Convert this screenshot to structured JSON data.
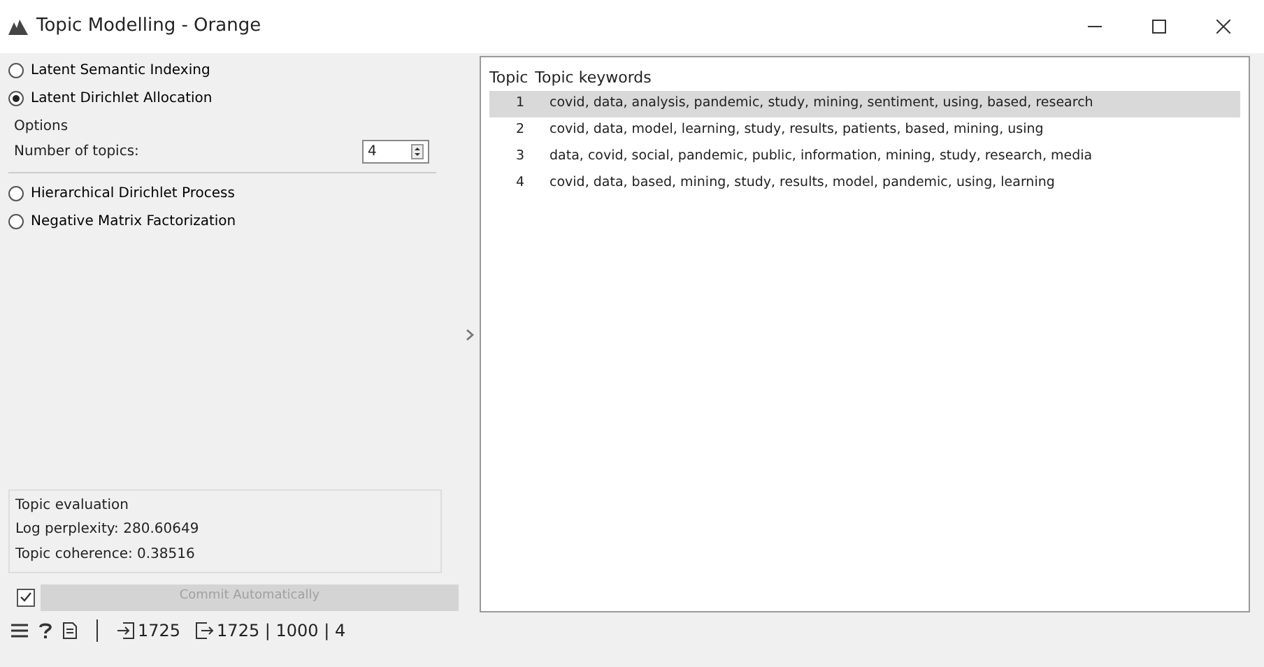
{
  "window": {
    "title": "Topic Modelling - Orange"
  },
  "methods": [
    {
      "label": "Latent Semantic Indexing",
      "selected": false
    },
    {
      "label": "Latent Dirichlet Allocation",
      "selected": true,
      "options": {
        "title": "Options",
        "label": "Number of topics:",
        "value": "4"
      }
    },
    {
      "label": "Hierarchical Dirichlet Process",
      "selected": false
    },
    {
      "label": "Negative Matrix Factorization",
      "selected": false
    }
  ],
  "evaluation": {
    "title": "Topic evaluation",
    "lines": [
      "Log perplexity: 280.60649",
      "Topic coherence: 0.38516"
    ]
  },
  "commit": {
    "checked": true,
    "disabled": true,
    "label": "Commit Automatically"
  },
  "table": {
    "columns": [
      "Topic",
      "Topic keywords"
    ],
    "rows": [
      {
        "topic": "1",
        "keywords": "covid, data, analysis, pandemic, study, mining, sentiment, using, based, research",
        "selected": true
      },
      {
        "topic": "2",
        "keywords": "covid, data, model, learning, study, results, patients, based, mining, using",
        "selected": false
      },
      {
        "topic": "3",
        "keywords": "data, covid, social, pandemic, public, information, mining, study, research, media",
        "selected": false
      },
      {
        "topic": "4",
        "keywords": "covid, data, based, mining, study, results, model, pandemic, using, learning",
        "selected": false
      }
    ]
  },
  "status_bar": {
    "input_count": "1725",
    "output_summary": "1725 | 1000 | 4"
  }
}
